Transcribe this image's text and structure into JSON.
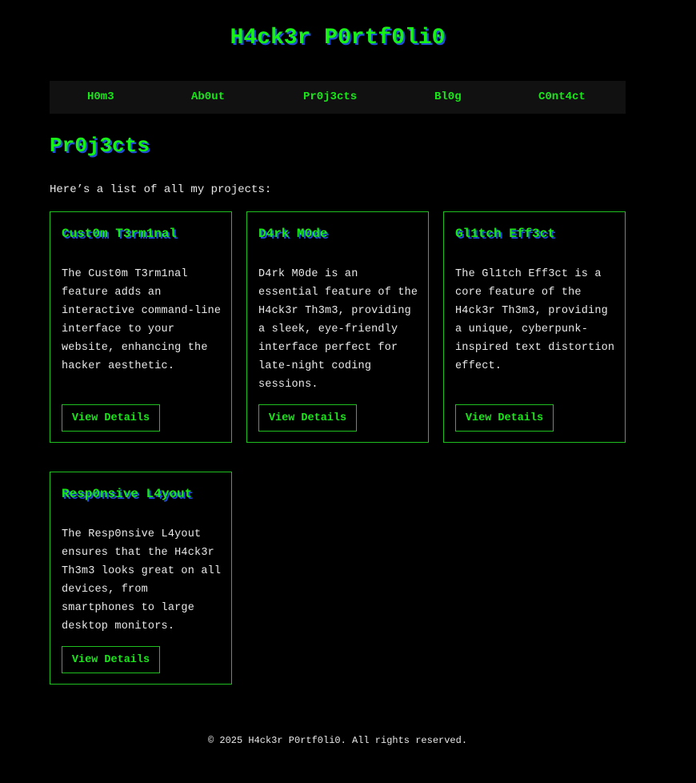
{
  "header": {
    "title": "H4ck3r P0rtf0li0"
  },
  "nav": {
    "items": [
      {
        "label": "H0m3"
      },
      {
        "label": "Ab0ut"
      },
      {
        "label": "Pr0j3cts"
      },
      {
        "label": "Bl0g"
      },
      {
        "label": "C0nt4ct"
      }
    ]
  },
  "main": {
    "heading": "Pr0j3cts",
    "intro": "Here’s a list of all my projects:",
    "projects": [
      {
        "title": "Cust0m T3rm1nal",
        "description": "The Cust0m T3rm1nal feature adds an interactive command-line interface to your website, enhancing the hacker aesthetic.",
        "button": "View Details"
      },
      {
        "title": "D4rk M0de",
        "description": "D4rk M0de is an essential feature of the H4ck3r Th3m3, providing a sleek, eye-friendly interface perfect for late-night coding sessions.",
        "button": "View Details"
      },
      {
        "title": "Gl1tch Eff3ct",
        "description": "The Gl1tch Eff3ct is a core feature of the H4ck3r Th3m3, providing a unique, cyberpunk-inspired text distortion effect.",
        "button": "View Details"
      },
      {
        "title": "Resp0nsive L4yout",
        "description": "The Resp0nsive L4yout ensures that the H4ck3r Th3m3 looks great on all devices, from smartphones to large desktop monitors.",
        "button": "View Details"
      }
    ]
  },
  "footer": {
    "text": "© 2025 H4ck3r P0rtf0li0. All rights reserved."
  },
  "colors": {
    "accent": "#19e619",
    "shadow": "#1f4fd6",
    "background": "#000000",
    "nav_background": "#111111"
  }
}
